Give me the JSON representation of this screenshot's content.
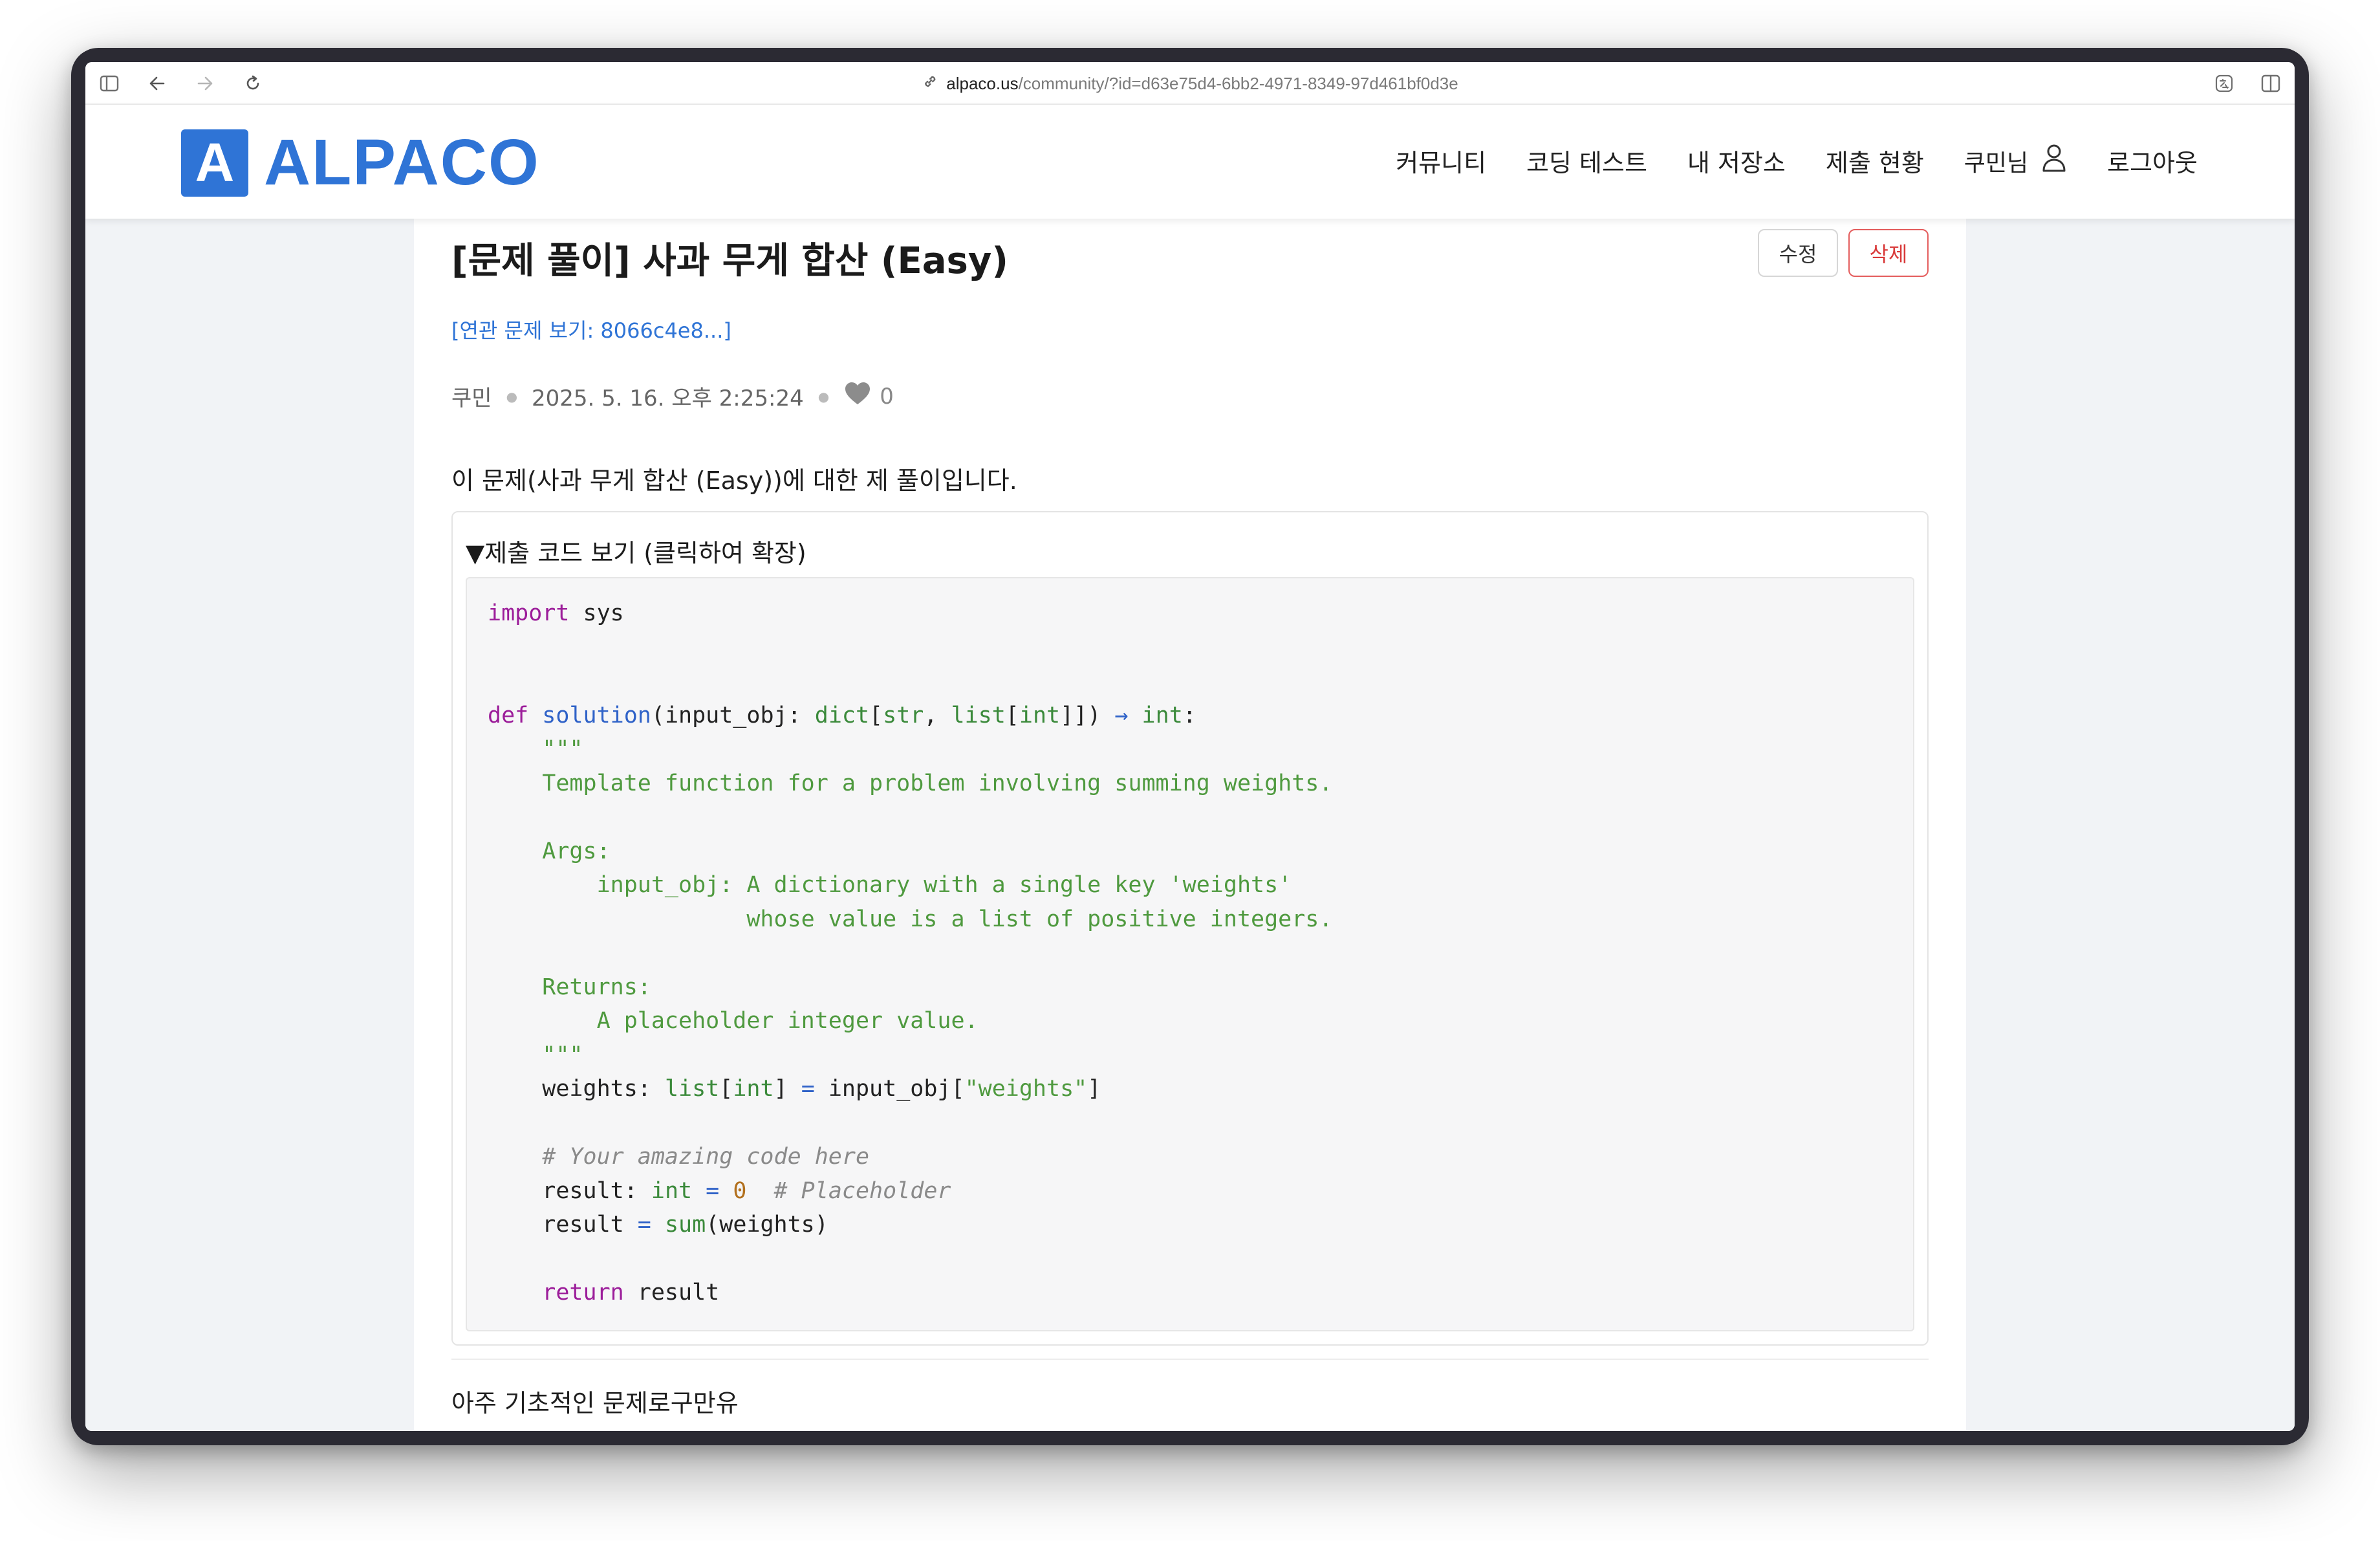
{
  "browser": {
    "url_domain": "alpaco.us",
    "url_path": "/community/?id=d63e75d4-6bb2-4971-8349-97d461bf0d3e"
  },
  "header": {
    "logo_letter": "A",
    "logo_text": "ALPACO",
    "nav": [
      "커뮤니티",
      "코딩 테스트",
      "내 저장소",
      "제출 현황"
    ],
    "user_label": "쿠민님",
    "logout_label": "로그아웃"
  },
  "post": {
    "title": "[문제 풀이] 사과 무게 합산 (Easy)",
    "edit_label": "수정",
    "delete_label": "삭제",
    "related_link": "[연관 문제 보기: 8066c4e8...]",
    "author": "쿠민",
    "date": "2025. 5. 16. 오후 2:25:24",
    "likes": "0",
    "intro": "이 문제(사과 무게 합산 (Easy))에 대한 제 풀이입니다.",
    "code_summary": "▼제출 코드 보기 (클릭하여 확장)",
    "footer_text": "아주 기초적인 문제로구만유"
  },
  "code": {
    "kw_import": "import",
    "mod_sys": " sys",
    "kw_def": "def",
    "fn_solution": "solution",
    "param": "(input_obj: ",
    "ty_dict": "dict",
    "br1": "[",
    "ty_str": "str",
    "comma": ", ",
    "ty_list": "list",
    "br2": "[",
    "ty_int": "int",
    "br3": "]])",
    "arrow": "→",
    "ret_ty": "int",
    "colon": ":",
    "doc_open": "    \"\"\"",
    "doc1": "    Template function for a problem involving summing weights.",
    "doc2": "    Args:",
    "doc3": "        input_obj: A dictionary with a single key 'weights'",
    "doc4": "                   whose value is a list of positive integers.",
    "doc5": "    Returns:",
    "doc6": "        A placeholder integer value.",
    "doc_close": "    \"\"\"",
    "w_name": "    weights: ",
    "w_list": "list",
    "w_br": "[",
    "w_int": "int",
    "w_br2": "] ",
    "w_eq": "=",
    "w_expr": " input_obj[",
    "w_key": "\"weights\"",
    "w_end": "]",
    "cm1": "    # Your amazing code here",
    "r1_name": "    result: ",
    "r1_int": "int",
    "r1_eq": " = ",
    "r1_zero": "0",
    "r1_cm": "  # Placeholder",
    "r2_name": "    result ",
    "r2_eq": "=",
    "r2_sum": " sum",
    "r2_arg": "(weights)",
    "ret_kw": "    return",
    "ret_val": " result"
  },
  "colors": {
    "brand": "#2f74d6",
    "danger": "#d93a3a"
  },
  "icons": [
    "sidebar-icon",
    "back-arrow-icon",
    "forward-arrow-icon",
    "reload-icon",
    "link-icon",
    "translate-icon",
    "split-view-icon",
    "user-icon",
    "heart-icon"
  ]
}
